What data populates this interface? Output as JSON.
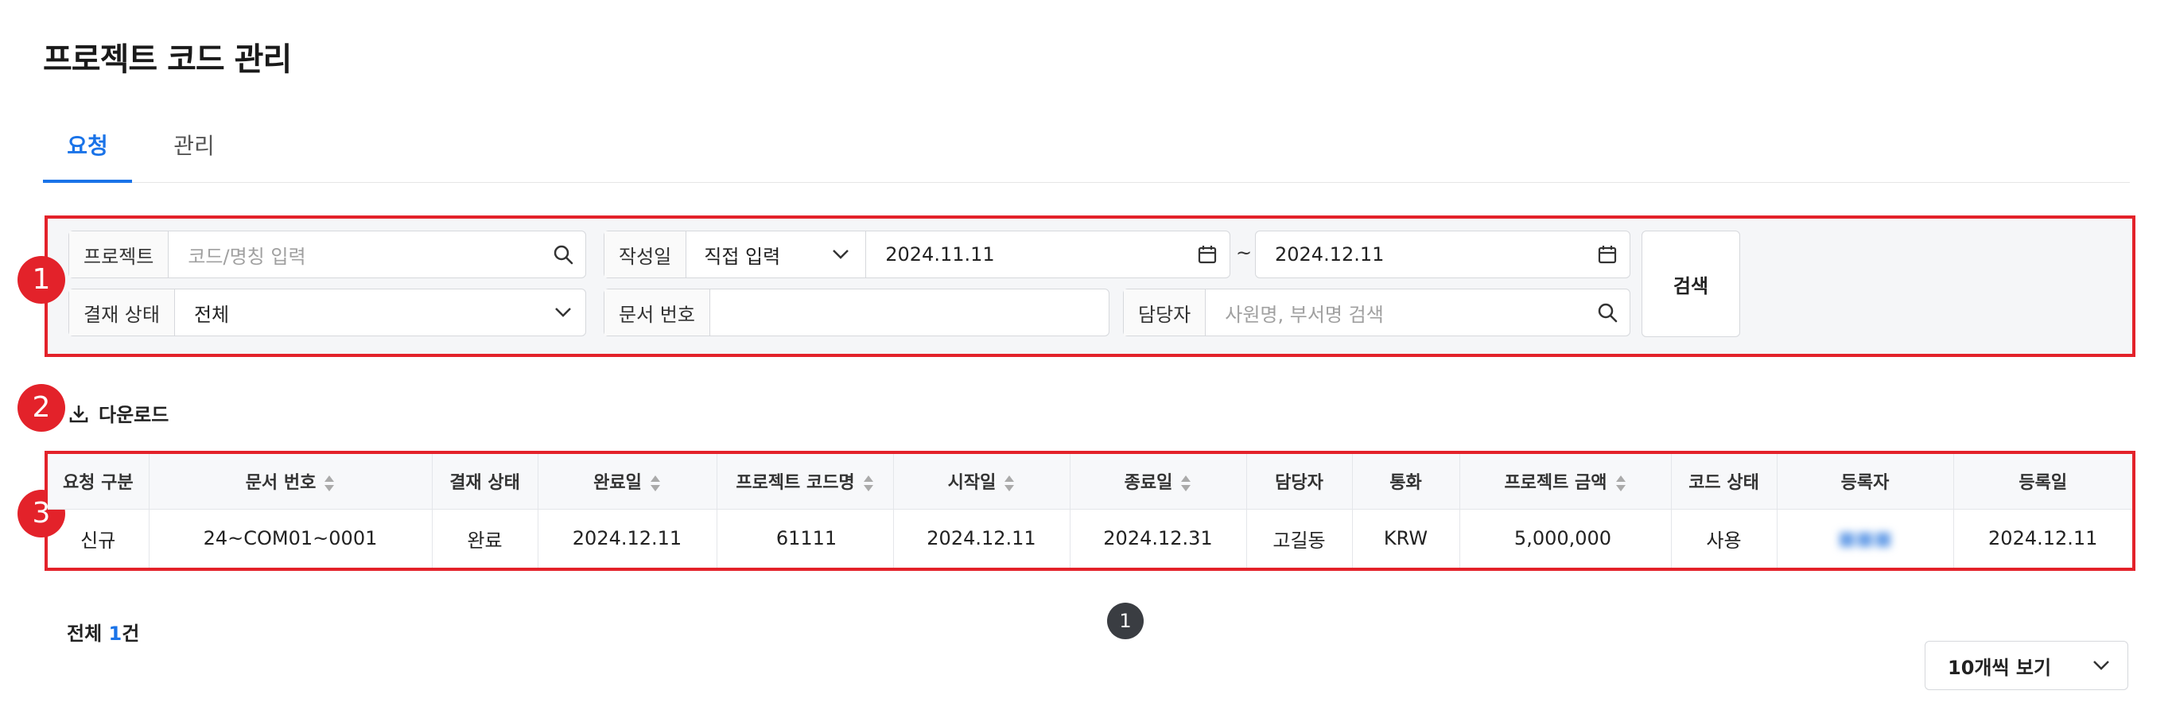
{
  "page": {
    "title": "프로젝트 코드 관리"
  },
  "tabs": [
    {
      "label": "요청",
      "active": true
    },
    {
      "label": "관리",
      "active": false
    }
  ],
  "markers": [
    "1",
    "2",
    "3"
  ],
  "filters": {
    "project": {
      "label": "프로젝트",
      "placeholder": "코드/명칭 입력",
      "icon": "search-icon"
    },
    "created": {
      "label": "작성일",
      "mode": "직접 입력",
      "from": "2024.11.11",
      "separator": "~",
      "to": "2024.12.11",
      "icon": "calendar-icon"
    },
    "approval_status": {
      "label": "결재 상태",
      "value": "전체"
    },
    "doc_number": {
      "label": "문서 번호",
      "value": ""
    },
    "manager": {
      "label": "담당자",
      "placeholder": "사원명, 부서명 검색",
      "icon": "search-icon"
    },
    "search_button": "검색"
  },
  "toolbar": {
    "download_label": "다운로드",
    "download_icon": "download-icon"
  },
  "table": {
    "columns": [
      "요청 구분",
      "문서 번호",
      "결재 상태",
      "완료일",
      "프로젝트 코드명",
      "시작일",
      "종료일",
      "담당자",
      "통화",
      "프로젝트 금액",
      "코드 상태",
      "등록자",
      "등록일"
    ],
    "sortable": [
      false,
      true,
      false,
      true,
      true,
      true,
      true,
      false,
      false,
      true,
      false,
      false,
      false
    ],
    "rows": [
      [
        "신규",
        "24~COM01~0001",
        "완료",
        "2024.12.11",
        "61111",
        "2024.12.11",
        "2024.12.31",
        "고길동",
        "KRW",
        "5,000,000",
        "사용",
        "■■■",
        "2024.12.11"
      ]
    ]
  },
  "footer": {
    "total_prefix": "전체",
    "total_count": "1",
    "total_suffix": "건",
    "current_page": "1",
    "page_size_label": "10개씩 보기"
  },
  "colors": {
    "accent": "#1a73e8",
    "highlight": "#e3222a",
    "pagination": "#3a3d42"
  }
}
